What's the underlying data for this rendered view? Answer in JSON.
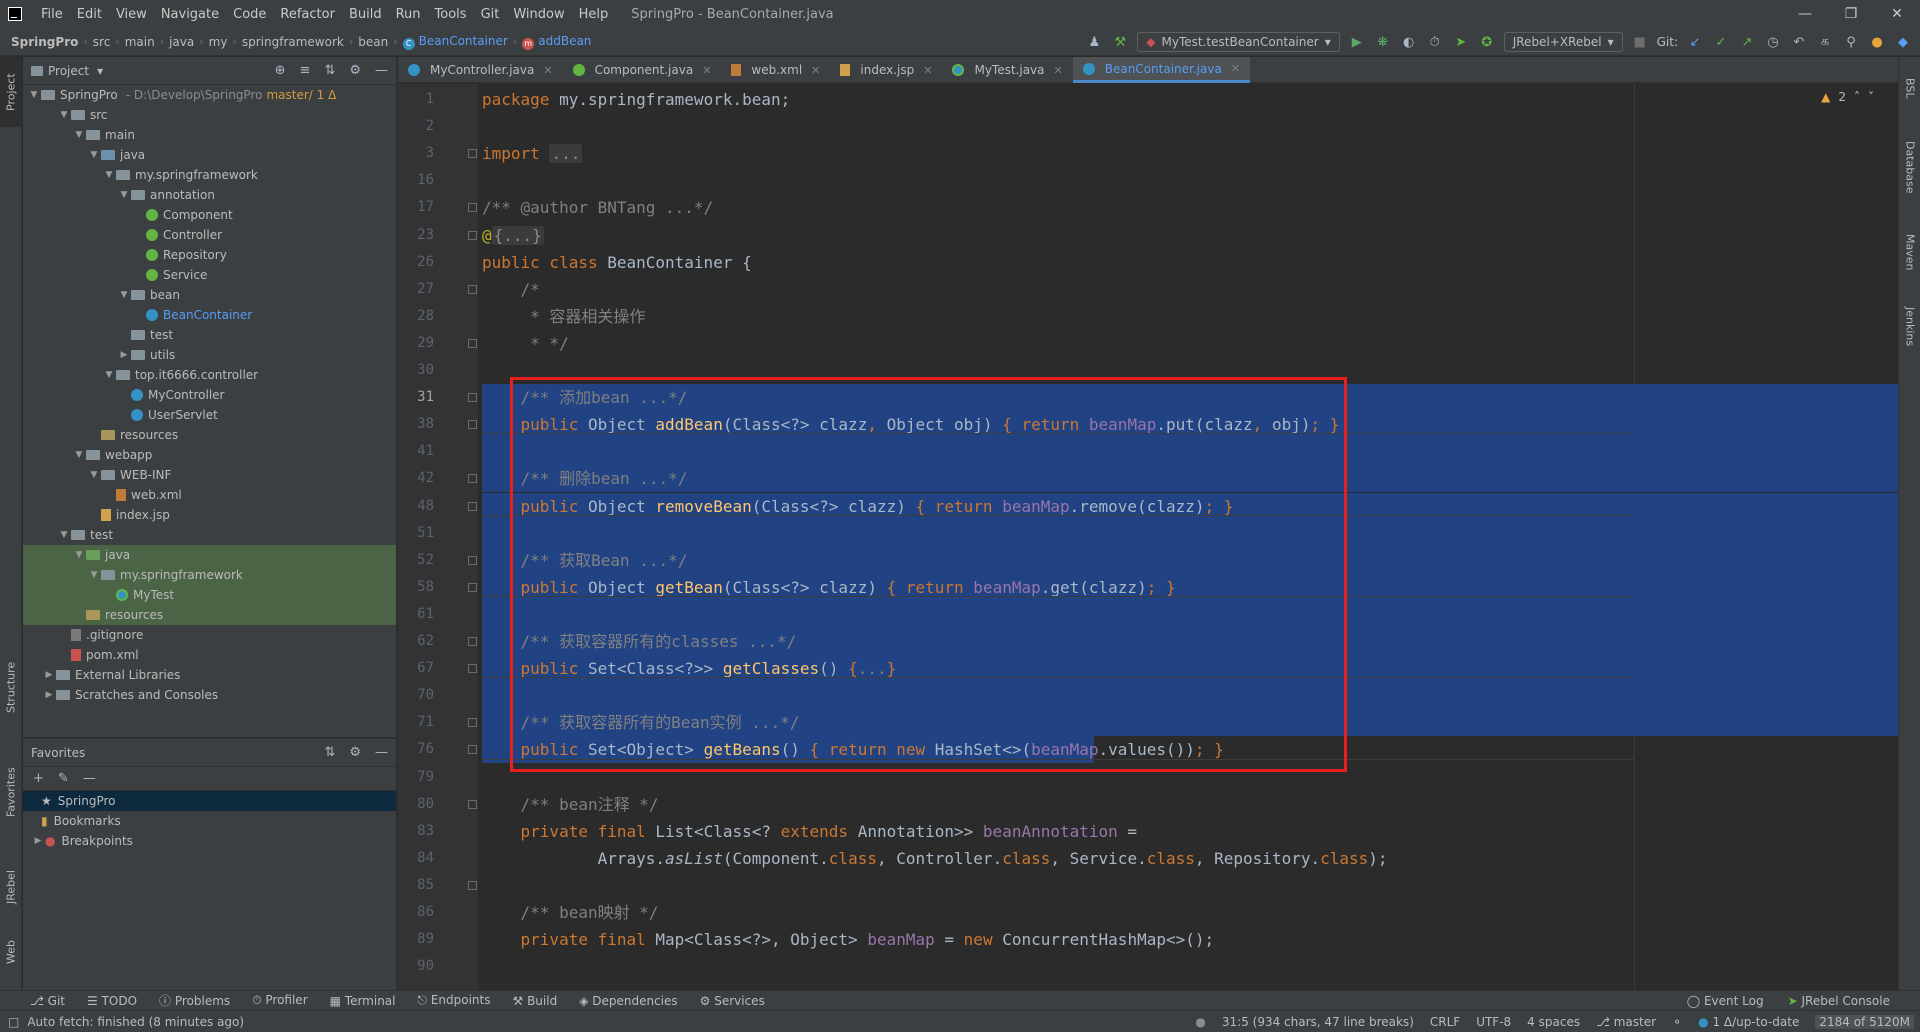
{
  "app": {
    "menu": [
      "File",
      "Edit",
      "View",
      "Navigate",
      "Code",
      "Refactor",
      "Build",
      "Run",
      "Tools",
      "Git",
      "Window",
      "Help"
    ],
    "window_title": "SpringPro - BeanContainer.java"
  },
  "breadcrumb": [
    "SpringPro",
    "src",
    "main",
    "java",
    "my",
    "springframework",
    "bean",
    "BeanContainer",
    "addBean"
  ],
  "toolbar": {
    "run_config": "MyTest.testBeanContainer",
    "jrebel_config": "JRebel+XRebel",
    "git_label": "Git:"
  },
  "project_panel": {
    "title": "Project",
    "root_name": "SpringPro",
    "root_path": "D:\\Develop\\SpringPro",
    "root_branch": "master/ 1 Δ",
    "items": [
      {
        "label": "src",
        "depth": 1,
        "kind": "folder",
        "open": true
      },
      {
        "label": "main",
        "depth": 2,
        "kind": "folder",
        "open": true
      },
      {
        "label": "java",
        "depth": 3,
        "kind": "src",
        "open": true
      },
      {
        "label": "my.springframework",
        "depth": 4,
        "kind": "pkg",
        "open": true
      },
      {
        "label": "annotation",
        "depth": 5,
        "kind": "pkg",
        "open": true
      },
      {
        "label": "Component",
        "depth": 6,
        "kind": "anno"
      },
      {
        "label": "Controller",
        "depth": 6,
        "kind": "anno"
      },
      {
        "label": "Repository",
        "depth": 6,
        "kind": "anno"
      },
      {
        "label": "Service",
        "depth": 6,
        "kind": "anno"
      },
      {
        "label": "bean",
        "depth": 5,
        "kind": "pkg",
        "open": true
      },
      {
        "label": "BeanContainer",
        "depth": 6,
        "kind": "class",
        "highlight": true
      },
      {
        "label": "test",
        "depth": 5,
        "kind": "pkg"
      },
      {
        "label": "utils",
        "depth": 5,
        "kind": "pkg",
        "closed": true
      },
      {
        "label": "top.it6666.controller",
        "depth": 4,
        "kind": "pkg",
        "open": true
      },
      {
        "label": "MyController",
        "depth": 5,
        "kind": "class"
      },
      {
        "label": "UserServlet",
        "depth": 5,
        "kind": "class"
      },
      {
        "label": "resources",
        "depth": 3,
        "kind": "res"
      },
      {
        "label": "webapp",
        "depth": 2,
        "kind": "folder",
        "open": true
      },
      {
        "label": "WEB-INF",
        "depth": 3,
        "kind": "folder",
        "open": true
      },
      {
        "label": "web.xml",
        "depth": 4,
        "kind": "xml"
      },
      {
        "label": "index.jsp",
        "depth": 3,
        "kind": "jsp"
      },
      {
        "label": "test",
        "depth": 1,
        "kind": "folder",
        "open": true
      },
      {
        "label": "java",
        "depth": 2,
        "kind": "test",
        "open": true,
        "selected": true
      },
      {
        "label": "my.springframework",
        "depth": 3,
        "kind": "pkg",
        "open": true,
        "selected": true
      },
      {
        "label": "MyTest",
        "depth": 4,
        "kind": "testclass",
        "selected": true
      },
      {
        "label": "resources",
        "depth": 2,
        "kind": "res",
        "selected": true
      },
      {
        "label": ".gitignore",
        "depth": 1,
        "kind": "git"
      },
      {
        "label": "pom.xml",
        "depth": 1,
        "kind": "mvn"
      },
      {
        "label": "External Libraries",
        "depth": 0,
        "kind": "lib",
        "closed": true
      },
      {
        "label": "Scratches and Consoles",
        "depth": 0,
        "kind": "scratch",
        "closed": true
      }
    ]
  },
  "favorites": {
    "title": "Favorites",
    "items": [
      "SpringPro",
      "Bookmarks",
      "Breakpoints"
    ]
  },
  "left_strip": [
    "Project",
    "Structure",
    "Favorites",
    "JRebel",
    "Web"
  ],
  "right_strip": [
    "BSL",
    "Database",
    "Maven",
    "Jenkins"
  ],
  "tabs": [
    {
      "label": "MyController.java",
      "icon": "class"
    },
    {
      "label": "Component.java",
      "icon": "anno"
    },
    {
      "label": "web.xml",
      "icon": "xml"
    },
    {
      "label": "index.jsp",
      "icon": "jsp"
    },
    {
      "label": "MyTest.java",
      "icon": "test"
    },
    {
      "label": "BeanContainer.java",
      "icon": "class",
      "active": true
    }
  ],
  "editor": {
    "warnings": "2",
    "lines": [
      {
        "n": "1",
        "html": "<span class='kw'>package</span> my.springframework.bean;"
      },
      {
        "n": "2",
        "html": ""
      },
      {
        "n": "3",
        "html": "<span class='kw'>import</span> <span class='foldbox'>...</span>"
      },
      {
        "n": "16",
        "html": ""
      },
      {
        "n": "17",
        "html": "<span class='cm'>/** @author BNTang ...*/</span>"
      },
      {
        "n": "23",
        "html": "<span class='ann'>@</span><span class='foldbox'>{...}</span>"
      },
      {
        "n": "26",
        "html": "<span class='kw'>public class</span> BeanContainer {"
      },
      {
        "n": "27",
        "html": "    <span class='cm'>/*</span>"
      },
      {
        "n": "28",
        "html": "    <span class='cm'> * 容器相关操作</span>"
      },
      {
        "n": "29",
        "html": "    <span class='cm'> * */</span>"
      },
      {
        "n": "30",
        "html": ""
      },
      {
        "n": "31",
        "html": "    <span class='cm'>/** 添加bean ...*/</span>",
        "cur": true
      },
      {
        "n": "38",
        "html": "    <span class='kw'>public</span> Object <span class='fn'>addBean</span>(Class&lt;?&gt; clazz<span class='kw'>,</span> Object obj) <span class='kw'>{ return</span> <span class='fld'>beanMap</span>.put(clazz<span class='kw'>,</span> obj)<span class='kw'>; }</span>"
      },
      {
        "n": "41",
        "html": ""
      },
      {
        "n": "42",
        "html": "    <span class='cm'>/** 删除bean ...*/</span>"
      },
      {
        "n": "48",
        "html": "    <span class='kw'>public</span> Object <span class='fn'>removeBean</span>(Class&lt;?&gt; clazz) <span class='kw'>{ return</span> <span class='fld'>beanMap</span>.remove(clazz)<span class='kw'>; }</span>"
      },
      {
        "n": "51",
        "html": ""
      },
      {
        "n": "52",
        "html": "    <span class='cm'>/** 获取Bean ...*/</span>"
      },
      {
        "n": "58",
        "html": "    <span class='kw'>public</span> Object <span class='fn'>getBean</span>(Class&lt;?&gt; clazz) <span class='kw'>{ return</span> <span class='fld'>beanMap</span>.get(clazz)<span class='kw'>; }</span>"
      },
      {
        "n": "61",
        "html": ""
      },
      {
        "n": "62",
        "html": "    <span class='cm'>/** 获取容器所有的classes ...*/</span>"
      },
      {
        "n": "67",
        "html": "    <span class='kw'>public</span> Set&lt;Class&lt;?&gt;&gt; <span class='fn'>getClasses</span>() <span class='kw'>{</span><span class='cm'>...</span><span class='kw'>}</span>"
      },
      {
        "n": "70",
        "html": ""
      },
      {
        "n": "71",
        "html": "    <span class='cm'>/** 获取容器所有的Bean实例 ...*/</span>"
      },
      {
        "n": "76",
        "html": "    <span class='kw'>public</span> Set&lt;Object&gt; <span class='fn'>getBeans</span>() <span class='kw'>{ return new</span> HashSet&lt;&gt;(<span class='fld'>beanMap</span>.values())<span class='kw'>; }</span>"
      },
      {
        "n": "79",
        "html": ""
      },
      {
        "n": "80",
        "html": "    <span class='cm'>/** bean注释 */</span>"
      },
      {
        "n": "83",
        "html": "    <span class='kw'>private final</span> List&lt;Class&lt;? <span class='kw'>extends</span> Annotation&gt;&gt; <span class='fld'>beanAnnotation</span> ="
      },
      {
        "n": "84",
        "html": "            Arrays.<span class='it'>asList</span>(Component.<span class='kw'>class</span>, Controller.<span class='kw'>class</span>, Service.<span class='kw'>class</span>, Repository.<span class='kw'>class</span>);"
      },
      {
        "n": "85",
        "html": ""
      },
      {
        "n": "86",
        "html": "    <span class='cm'>/** bean映射 */</span>"
      },
      {
        "n": "89",
        "html": "    <span class='kw'>private final</span> Map&lt;Class&lt;?&gt;, Object&gt; <span class='fld'>beanMap</span> = <span class='kw'>new</span> ConcurrentHashMap&lt;&gt;();"
      },
      {
        "n": "90",
        "html": ""
      }
    ]
  },
  "bottom_tools": [
    "Git",
    "TODO",
    "Problems",
    "Profiler",
    "Terminal",
    "Endpoints",
    "Build",
    "Dependencies",
    "Services"
  ],
  "bottom_tools_right": [
    "Event Log",
    "JRebel Console"
  ],
  "status": {
    "left": "Auto fetch: finished (8 minutes ago)",
    "position": "31:5 (934 chars, 47 line breaks)",
    "line_sep": "CRLF",
    "encoding": "UTF-8",
    "indent": "4 spaces",
    "branch": "master",
    "vcs": "1 Δ/up-to-date",
    "memory": "2184 of 5120M"
  }
}
